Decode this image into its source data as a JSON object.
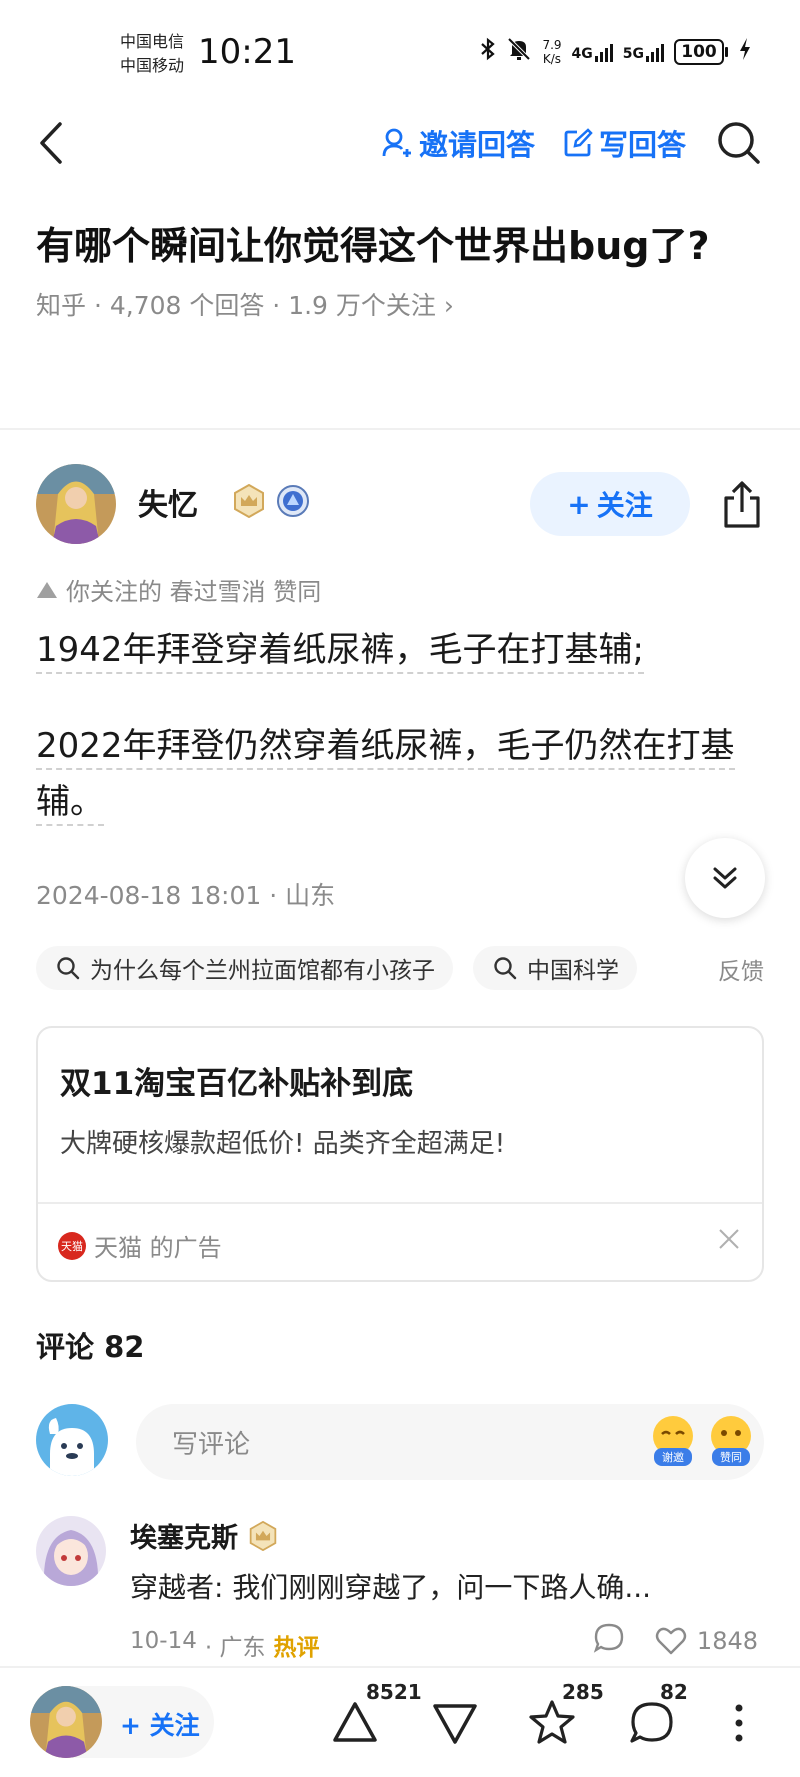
{
  "status_bar": {
    "carrier_1": "中国电信",
    "carrier_2": "中国移动",
    "time": "10:21",
    "net_speed_value": "7.9",
    "net_speed_unit": "K/s",
    "signal_1": "4G",
    "signal_2": "5G",
    "battery": "100"
  },
  "toolbar": {
    "invite_label": "邀请回答",
    "write_label": "写回答"
  },
  "question": {
    "title": "有哪个瞬间让你觉得这个世界出bug了?",
    "meta": "知乎 · 4,708 个回答 · 1.9 万个关注 ›"
  },
  "author": {
    "name": "失忆",
    "follow_label": "关注"
  },
  "endorse": {
    "text": "你关注的 春过雪消 赞同"
  },
  "answer": {
    "paragraph_1": "1942年拜登穿着纸尿裤，毛子在打基辅;",
    "paragraph_2": "2022年拜登仍然穿着纸尿裤，毛子仍然在打基辅。",
    "meta": "2024-08-18 18:01 · 山东"
  },
  "related": {
    "items": [
      "为什么每个兰州拉面馆都有小孩子",
      "中国科学"
    ],
    "feedback": "反馈"
  },
  "ad": {
    "title": "双11淘宝百亿补贴补到底",
    "description": "大牌硬核爆款超低价! 品类齐全超满足!",
    "logo_text": "天猫",
    "source": "天猫 的广告"
  },
  "comments": {
    "header": "评论 82",
    "input_placeholder": "写评论",
    "emoji_1_label": "谢邀",
    "emoji_2_label": "赞同",
    "items": [
      {
        "author": "埃塞克斯",
        "text": "穿越者: 我们刚刚穿越了，问一下路人确...",
        "date": "10-14",
        "location": "· 广东",
        "tag": "热评",
        "likes": "1848"
      }
    ]
  },
  "bottom_bar": {
    "follow_label": "+ 关注",
    "upvotes": "8521",
    "favorites": "285",
    "comments": "82"
  },
  "colors": {
    "accent": "#1772f6",
    "muted": "#8a8a8a",
    "hot": "#e0a200"
  }
}
